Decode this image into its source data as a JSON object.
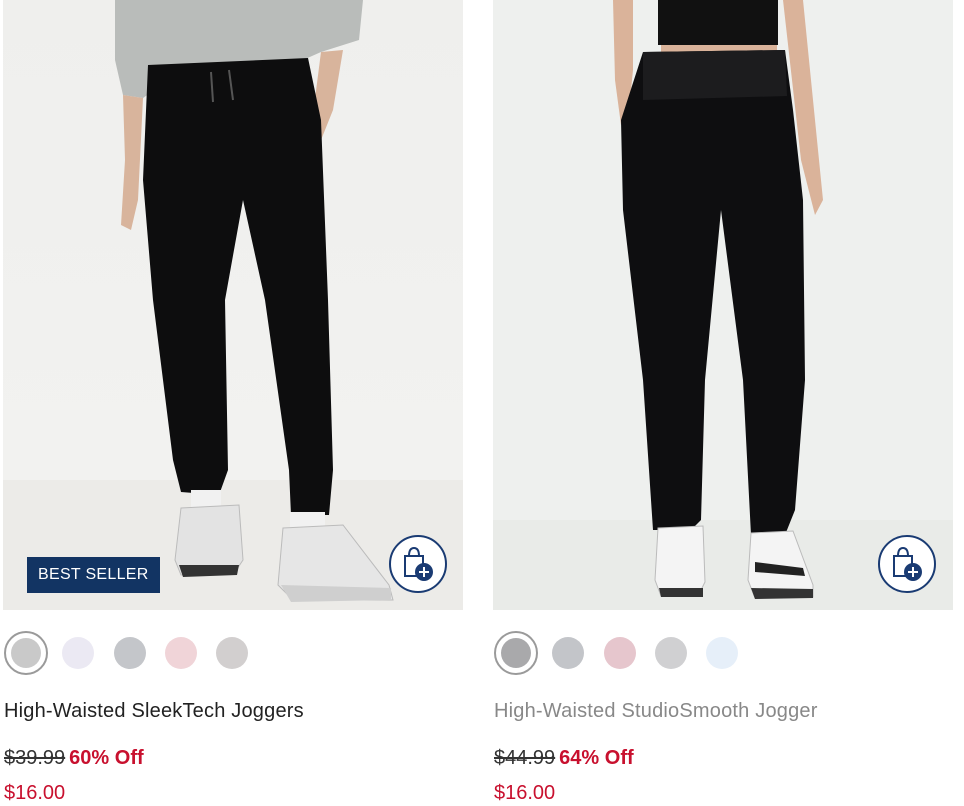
{
  "products": [
    {
      "badge": "BEST SELLER",
      "title": "High-Waisted SleekTech Joggers",
      "original_price": "$39.99",
      "discount": "60% Off",
      "sale_price": "$16.00",
      "swatch_colors": [
        "#c9c9c9",
        "#ebe9f3",
        "#c4c6ca",
        "#f0d4d8",
        "#d2cfcf"
      ],
      "selected_swatch": 0,
      "add_to_bag_icon": "shopping-bag-plus-icon"
    },
    {
      "badge": "",
      "title": "High-Waisted StudioSmooth Jogger",
      "original_price": "$44.99",
      "discount": "64% Off",
      "sale_price": "$16.00",
      "swatch_colors": [
        "#a9a9ab",
        "#c3c5c9",
        "#e6c6cd",
        "#d0d0d2",
        "#e6eff9"
      ],
      "selected_swatch": 0,
      "add_to_bag_icon": "shopping-bag-plus-icon"
    }
  ],
  "colors": {
    "badge_bg": "#123463",
    "sale_red": "#c8102e",
    "bag_border": "#1a3b73"
  }
}
